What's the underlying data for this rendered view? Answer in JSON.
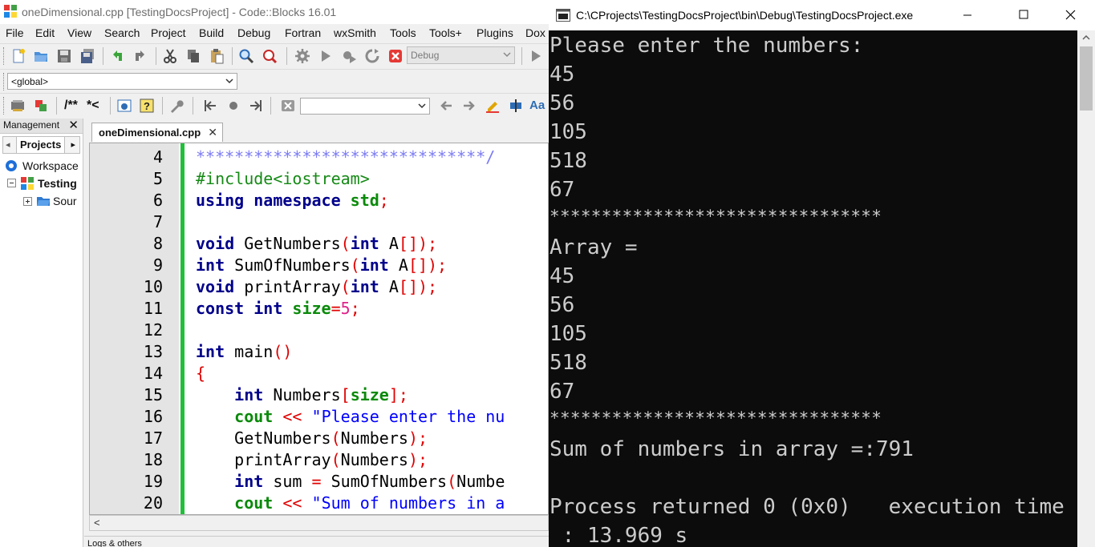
{
  "ide": {
    "title": "oneDimensional.cpp [TestingDocsProject] - Code::Blocks 16.01",
    "menu": [
      "File",
      "Edit",
      "View",
      "Search",
      "Project",
      "Build",
      "Debug",
      "Fortran",
      "wxSmith",
      "Tools",
      "Tools+",
      "Plugins",
      "Dox"
    ],
    "build_target": "Debug",
    "scope_combo": "<global>",
    "comment_tools": [
      "/**",
      "*<"
    ],
    "management": {
      "header": "Management",
      "tab_active": "Projects",
      "tree": [
        "Workspace",
        "Testing",
        "Sour"
      ]
    },
    "editor_tab": "oneDimensional.cpp",
    "line_numbers": [
      "4",
      "5",
      "6",
      "7",
      "8",
      "9",
      "10",
      "11",
      "12",
      "13",
      "14",
      "15",
      "16",
      "17",
      "18",
      "19",
      "20"
    ],
    "code": {
      "l4": "******************************/",
      "l5": "#include<iostream>",
      "l6_kw": "using namespace",
      "l6_id": "std",
      "l8_type": "void",
      "l8_name": "GetNumbers",
      "l9_type": "int",
      "l9_name": "SumOfNumbers",
      "l10_type": "void",
      "l10_name": "printArray",
      "param_type": "int",
      "param_name": "A",
      "l11_kw": "const int",
      "l11_id": "size",
      "l11_val": "5",
      "l13_type": "int",
      "l13_name": "main",
      "l15_type": "int",
      "l15_name": "Numbers",
      "l15_size": "size",
      "cout": "cout",
      "l16_str": "\"Please enter the nu",
      "l17_call": "GetNumbers",
      "l17_arg": "Numbers",
      "l18_call": "printArray",
      "l18_arg": "Numbers",
      "l19_type": "int",
      "l19_var": "sum",
      "l19_call": "SumOfNumbers",
      "l19_arg": "Numbe",
      "l20_str": "\"Sum of numbers in a"
    },
    "logs_tab": "Logs & others"
  },
  "console": {
    "title": "C:\\CProjects\\TestingDocsProject\\bin\\Debug\\TestingDocsProject.exe",
    "lines": {
      "prompt": "Please enter the numbers:",
      "in1": "45",
      "in2": "56",
      "in3": "105",
      "in4": "518",
      "in5": "67",
      "stars1": "********************************",
      "array_label": "Array =",
      "out1": "45",
      "out2": "56",
      "out3": "105",
      "out4": "518",
      "out5": "67",
      "stars2": "********************************",
      "sum": "Sum of numbers in array =:791",
      "process": "Process returned 0 (0x0)   execution time",
      "time": " : 13.969 s"
    }
  }
}
